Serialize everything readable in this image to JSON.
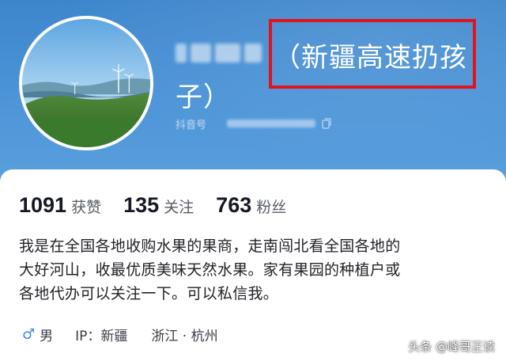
{
  "profile": {
    "name_visible": "（新疆高速扔孩子）",
    "name_line1": "（新疆高速扔孩",
    "name_line2": "子）",
    "douyin_label": "抖音号"
  },
  "stats": [
    {
      "value": "1091",
      "label": "获赞"
    },
    {
      "value": "135",
      "label": "关注"
    },
    {
      "value": "763",
      "label": "粉丝"
    }
  ],
  "bio": {
    "line1": "我是在全国各地收购水果的果商，走南闯北看全国各地的",
    "line2": "大好河山，收最优质美味天然水果。家有果园的种植户或",
    "line3": "各地代办可以关注一下。可以私信我。"
  },
  "meta": {
    "gender_icon": "♂",
    "gender": "男",
    "ip": "IP：新疆",
    "location": "浙江 · 杭州"
  },
  "watermark": "头条 @峰哥正读",
  "colors": {
    "header_blue": "#4a92d6",
    "highlight_red": "#e0141c",
    "gender_blue": "#3f8ce4"
  },
  "icons": [
    "avatar-landscape",
    "male-icon",
    "copy-icon"
  ]
}
